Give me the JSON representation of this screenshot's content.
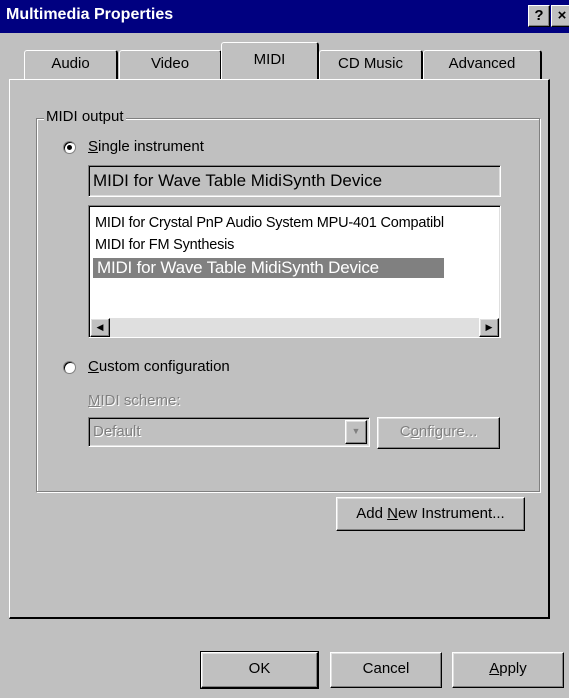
{
  "window": {
    "title": "Multimedia Properties",
    "help_button": "?",
    "close_button": "×"
  },
  "tabs": [
    {
      "label": "Audio"
    },
    {
      "label": "Video"
    },
    {
      "label": "MIDI",
      "active": true
    },
    {
      "label": "CD Music"
    },
    {
      "label": "Advanced"
    }
  ],
  "midi_output": {
    "group_label": "MIDI output",
    "single_instrument": {
      "label_mnemonic": "S",
      "label_rest": "ingle instrument",
      "selected": true
    },
    "selected_instrument_display": "MIDI for Wave Table MidiSynth Device",
    "instrument_list": [
      {
        "label": "MIDI for Crystal PnP Audio System MPU-401 Compatibl"
      },
      {
        "label": "MIDI for FM Synthesis"
      },
      {
        "label": "MIDI for Wave Table MidiSynth Device",
        "selected": true
      }
    ],
    "scroll_left_glyph": "◀",
    "scroll_right_glyph": "▶",
    "custom_configuration": {
      "label_mnemonic": "C",
      "label_rest": "ustom configuration",
      "selected": false
    },
    "midi_scheme": {
      "label_mnemonic": "M",
      "label_rest": "IDI scheme:",
      "value": "Default",
      "dropdown_glyph": "▼"
    },
    "configure_button": {
      "pre": "C",
      "mnemonic": "o",
      "post": "nfigure..."
    }
  },
  "add_instrument_button": {
    "pre": "Add ",
    "mnemonic": "N",
    "post": "ew Instrument..."
  },
  "footer": {
    "ok": "OK",
    "cancel": "Cancel",
    "apply_mnemonic": "A",
    "apply_rest": "pply"
  },
  "colors": {
    "title_bar": "#000080",
    "face": "#c0c0c0",
    "selection": "#808080"
  }
}
